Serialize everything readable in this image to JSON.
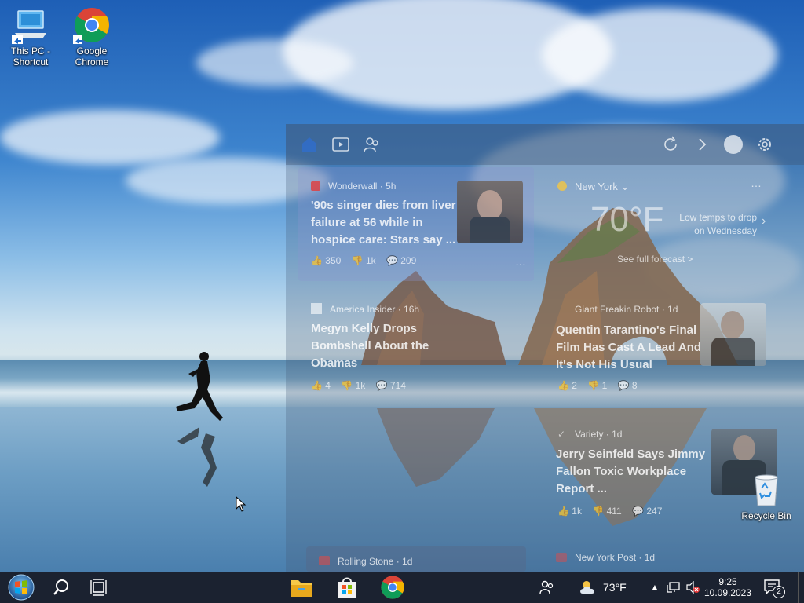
{
  "desktop": {
    "icons": [
      {
        "label": "This PC -\nShortcut"
      },
      {
        "label": "Google\nChrome"
      },
      {
        "label": "Recycle Bin"
      }
    ]
  },
  "widgets": {
    "tabs": [
      "home-icon",
      "video-icon",
      "people-icon"
    ],
    "cards": [
      {
        "source": "Wonderwall · 5h",
        "title": "'90s singer dies from liver failure at 56 while in hospice care: Stars say ...",
        "likes": "350",
        "dislikes": "1k",
        "comments": "209"
      },
      {
        "source": "America Insider · 16h",
        "title": "Megyn Kelly Drops Bombshell About the Obamas",
        "likes": "4",
        "dislikes": "1k",
        "comments": "714"
      },
      {
        "source": "Giant Freakin Robot · 1d",
        "title": "Quentin Tarantino's Final Film Has Cast A Lead And It's Not His Usual",
        "likes": "2",
        "dislikes": "1",
        "comments": "8"
      },
      {
        "source": "Variety · 1d",
        "title": "Jerry Seinfeld Says Jimmy Fallon Toxic Workplace Report ...",
        "likes": "1k",
        "dislikes": "411",
        "comments": "247"
      },
      {
        "source": "Rolling Stone · 1d",
        "title": ""
      },
      {
        "source": "New York Post · 1d",
        "title": ""
      }
    ],
    "weather": {
      "location": "New York",
      "temp": "70°F",
      "note": "Low temps to drop on Wednesday",
      "link": "See full forecast >"
    }
  },
  "taskbar": {
    "weather_temp": "73°F",
    "time": "9:25",
    "date": "10.09.2023",
    "notification_count": "2"
  },
  "colors": {
    "taskbar": "#1b2230",
    "accent": "#4a90e2"
  }
}
